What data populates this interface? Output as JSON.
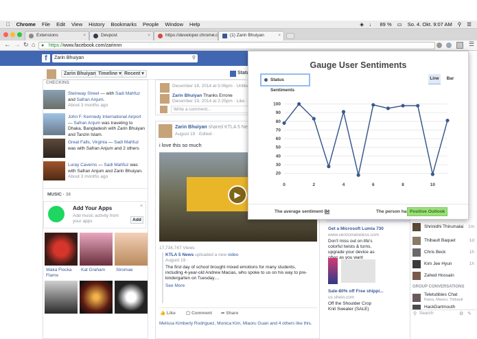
{
  "menubar": {
    "app": "Chrome",
    "items": [
      "File",
      "Edit",
      "View",
      "History",
      "Bookmarks",
      "People",
      "Window",
      "Help"
    ],
    "battery": "89 %",
    "clock": "So. 4. Okt.  9:07 AM"
  },
  "tabs": [
    {
      "label": "Extensions",
      "active": false
    },
    {
      "label": "Devpost",
      "active": false
    },
    {
      "label": "https://developer.chrome.c",
      "active": false
    },
    {
      "label": "(1) Zarin Bhuiyan",
      "active": true
    }
  ],
  "address": {
    "scheme": "https://",
    "host": "www.facebook.com",
    "path": "/zarinnn"
  },
  "fb": {
    "search_value": "Zarin Bhuiyan",
    "profile_name": "Zarin Bhuiyan",
    "timeline_label": "Timeline",
    "recent_label": "Recent",
    "status_label": "Status"
  },
  "checkins": {
    "header": "CHECKINS",
    "items": [
      {
        "place": "Steinway Street",
        "with": "Sadi Mahfuz",
        "and": "Safran Anjum",
        "time": "About 3 months ago"
      },
      {
        "place": "John F. Kennedy International Airport",
        "with": "Safran Anjum",
        "extra": "was traveling to Dhaka, Bangladesh with Zarin Bhuiyan and Tanzin Islam."
      },
      {
        "place": "Great Falls, Virginia",
        "with": "Sadi Mahfuz",
        "extra": "was with Safran Anjum and 2 others"
      },
      {
        "place": "Luray Caverns",
        "with": "Sadi Mahfuz",
        "extra": "was with Safran Anjum and Zarin Bhuiyan.",
        "time": "About 3 months ago"
      }
    ]
  },
  "music": {
    "header": "MUSIC",
    "count": "38",
    "add_title": "Add Your Apps",
    "add_sub": "Add music activity from your apps",
    "add_button": "Add",
    "artists": [
      "Waka Flocka Flame",
      "Kat Graham",
      "Stromae"
    ]
  },
  "feed": {
    "comment1_name": "Zarin Bhuiyan",
    "comment1_meta": "December 18, 2014 at 5:06pm · Unlike · 1",
    "comment2_name": "Zarin Bhuiyan",
    "comment2_text": "Thanks Errone",
    "comment2_meta": "December 19, 2014 at 2:25pm · Like · 1",
    "comment_placeholder": "Write a comment...",
    "post_author": "Zarin Bhuiyan",
    "post_shared": "shared KTLA 5 New",
    "post_meta": "August 19 · Edited ·",
    "post_text": "i love this so much",
    "video_views": "17,734,747 Views",
    "src_name": "KTLA 5 News",
    "src_action": "uploaded a new",
    "src_link": "video",
    "src_date": "August 19 ·",
    "src_text": "The first day of school brought mixed emotions for many students, including 4-year-old Andrew Macias, who spoke to us on his way to pre-kindergarten on Tuesday....",
    "see_more": "See More",
    "like": "Like",
    "comment": "Comment",
    "share": "Share",
    "likers": "Melissa Kimberly Rodriguez, Monica Kim, Miaoru Guan and 4 others like this."
  },
  "ads": [
    {
      "title": "Get a Microsoft Lumia 730",
      "url": "www.verizonwireless.com",
      "text": "Don't miss out on life's colorful twists & turns, upgrade your device as often as you want"
    },
    {
      "title": "Sale-80% off Free shippi...",
      "url": "us.shein.com",
      "text": "Off the Shoulder Crop Knit Sweater (SALE)"
    }
  ],
  "chat": {
    "people": [
      {
        "name": "Shrinidhi Thirumalai",
        "status": "1m"
      },
      {
        "name": "Thibault Baquet",
        "status": "1d"
      },
      {
        "name": "Chris Beck",
        "status": "1h"
      },
      {
        "name": "Kim Jee Hyun",
        "status": "1h"
      },
      {
        "name": "Zahed Hossain",
        "status": ""
      }
    ],
    "group_header": "GROUP CONVERSATIONS",
    "groups": [
      {
        "name": "Teletubbies Chat",
        "members": "Raisa, Miaoru, Thibault"
      },
      {
        "name": "HackDartmouth",
        "members": ""
      }
    ],
    "search_placeholder": "Search"
  },
  "popup": {
    "title": "Gauge User Sentiments",
    "legend": "Status Sentiments",
    "toggle_line": "Line",
    "toggle_bar": "Bar",
    "avg_label": "The average sentiment is:",
    "avg_value": "74",
    "person_label": "The person has:",
    "outlook": "Positive Outlook",
    "colors": {
      "line": "#3b5a8c",
      "grid": "#e9e9e9",
      "outlook_bg": "#9ce07a"
    }
  },
  "chart_data": {
    "type": "line",
    "x": [
      0,
      1,
      2,
      3,
      4,
      5,
      6,
      7,
      8,
      9,
      10,
      11
    ],
    "series": [
      {
        "name": "Status Sentiments",
        "values": [
          78,
          100,
          83,
          28,
          91,
          18,
          99,
          95,
          98,
          98,
          19,
          81
        ]
      }
    ],
    "xticks": [
      0,
      2,
      4,
      6,
      8,
      10
    ],
    "yticks": [
      20,
      30,
      40,
      50,
      60,
      70,
      80,
      90,
      100
    ],
    "ylim": [
      15,
      102
    ],
    "xlim": [
      0,
      11
    ],
    "grid": true
  }
}
